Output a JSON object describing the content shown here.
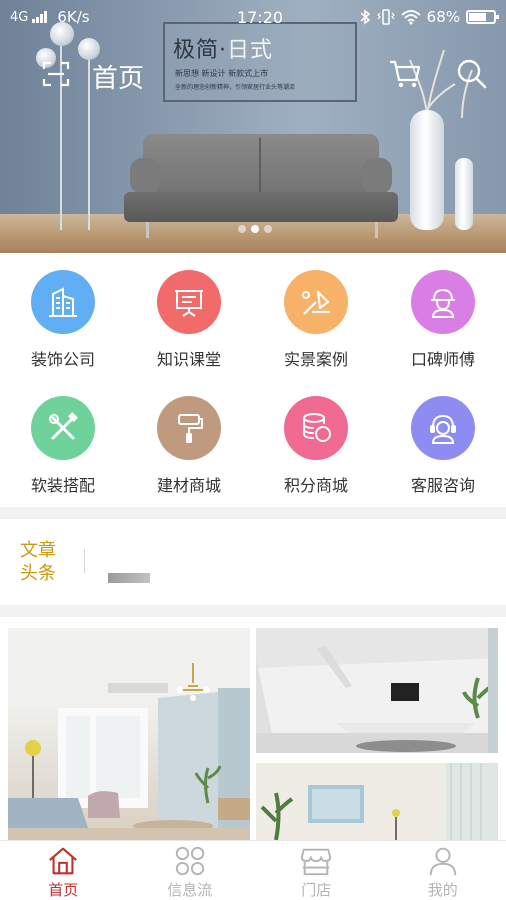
{
  "status_bar": {
    "network": "4G",
    "speed": "6K/s",
    "time": "17:20",
    "battery": "68%"
  },
  "header": {
    "title": "首页",
    "scan_icon": "scan-icon",
    "cart_icon": "cart-icon",
    "search_icon": "search-icon"
  },
  "banner": {
    "poster_title_main": "极简",
    "poster_title_dot": "·",
    "poster_title_accent": "日式",
    "poster_subtitle": "新思想 新设计 新款式上市",
    "poster_slogan": "全新的理念创新精神，引领家居行业头等潮流",
    "slides_total": 3,
    "active_slide": 2
  },
  "categories": [
    {
      "label": "装饰公司",
      "icon": "building-icon",
      "color": "#62aef4"
    },
    {
      "label": "知识课堂",
      "icon": "presentation-board-icon",
      "color": "#f26b6b"
    },
    {
      "label": "实景案例",
      "icon": "trowel-icon",
      "color": "#f7b267"
    },
    {
      "label": "口碑师傅",
      "icon": "worker-helmet-icon",
      "color": "#d97ee4"
    },
    {
      "label": "软装搭配",
      "icon": "tools-icon",
      "color": "#6fd29a"
    },
    {
      "label": "建材商城",
      "icon": "paint-roller-icon",
      "color": "#c09a7e"
    },
    {
      "label": "积分商城",
      "icon": "coins-icon",
      "color": "#f06a92"
    },
    {
      "label": "客服咨询",
      "icon": "customer-service-icon",
      "color": "#8e8cf0"
    }
  ],
  "headlines": {
    "tag_line1": "文章",
    "tag_line2": "头条"
  },
  "tabs": [
    {
      "label": "首页",
      "icon": "home-icon",
      "active": true
    },
    {
      "label": "信息流",
      "icon": "feed-grid-icon",
      "active": false
    },
    {
      "label": "门店",
      "icon": "store-icon",
      "active": false
    },
    {
      "label": "我的",
      "icon": "user-icon",
      "active": false
    }
  ],
  "colors": {
    "accent": "#c0302e",
    "headline_tag": "#c79a12",
    "tab_inactive": "#b4b4b4"
  }
}
